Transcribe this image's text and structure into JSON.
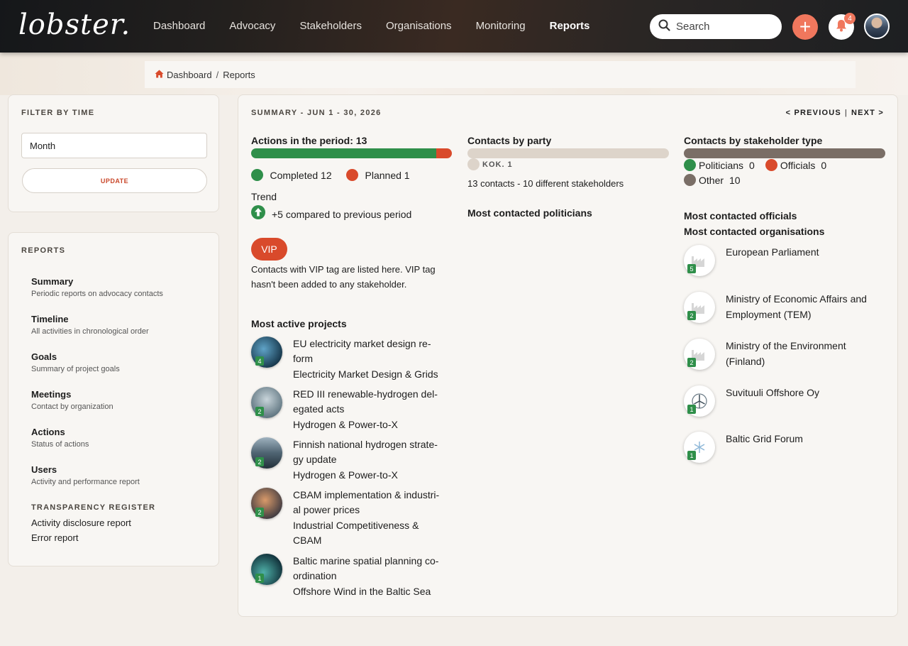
{
  "header": {
    "logo": "lobster.",
    "nav": [
      {
        "label": "Dashboard",
        "active": false
      },
      {
        "label": "Advocacy",
        "active": false
      },
      {
        "label": "Stakeholders",
        "active": false
      },
      {
        "label": "Organisations",
        "active": false
      },
      {
        "label": "Monitoring",
        "active": false
      },
      {
        "label": "Reports",
        "active": true
      }
    ],
    "search_placeholder": "Search",
    "notification_count": "4",
    "plus": "+"
  },
  "breadcrumb": {
    "home": "Dashboard",
    "sep": "/",
    "current": "Reports"
  },
  "filter": {
    "title": "FILTER BY TIME",
    "selected": "Month",
    "update_label": "UPDATE"
  },
  "reports": {
    "title": "REPORTS",
    "items": [
      {
        "title": "Summary",
        "desc": "Periodic reports on advocacy contacts"
      },
      {
        "title": "Timeline",
        "desc": "All activities in chronological order"
      },
      {
        "title": "Goals",
        "desc": "Summary of project goals"
      },
      {
        "title": "Meetings",
        "desc": "Contact by organization"
      },
      {
        "title": "Actions",
        "desc": "Status of actions"
      },
      {
        "title": "Users",
        "desc": "Activity and performance report"
      }
    ],
    "transparency_title": "TRANSPARENCY REGISTER",
    "transparency_links": [
      "Activity disclosure report",
      "Error report"
    ]
  },
  "summary": {
    "title": "SUMMARY - JUN 1 - 30, 2026",
    "prev": "< PREVIOUS",
    "pager_sep": "|",
    "next": "NEXT >",
    "actions": {
      "heading": "Actions in the period: 13",
      "completed_label": "Completed 12",
      "planned_label": "Planned 1",
      "completed": 12,
      "planned": 1,
      "colors": {
        "completed": "#2f8f4a",
        "planned": "#d94a2b"
      }
    },
    "trend": {
      "heading": "Trend",
      "text": "+5 compared to previous period"
    },
    "vip": {
      "label": "VIP",
      "text_line1": "Contacts with VIP tag are listed here. VIP tag",
      "text_line2": "hasn't been added to any stakeholder."
    },
    "projects": {
      "heading": "Most active projects",
      "items": [
        {
          "count": "4",
          "line1": "EU electricity market design re-",
          "line2": "form",
          "line3": "Electricity Market Design & Grids",
          "line4": ""
        },
        {
          "count": "2",
          "line1": "RED III renewable-hydrogen del-",
          "line2": "egated acts",
          "line3": "Hydrogen & Power-to-X",
          "line4": ""
        },
        {
          "count": "2",
          "line1": "Finnish national hydrogen strate-",
          "line2": "gy update",
          "line3": "Hydrogen & Power-to-X",
          "line4": ""
        },
        {
          "count": "2",
          "line1": "CBAM implementation & industri-",
          "line2": "al power prices",
          "line3": "Industrial Competitiveness &",
          "line4": "CBAM"
        },
        {
          "count": "1",
          "line1": "Baltic marine spatial planning co-",
          "line2": "ordination",
          "line3": "Offshore Wind in the Baltic Sea",
          "line4": ""
        }
      ]
    },
    "party": {
      "heading": "Contacts by party",
      "legend": "KOK. 1",
      "bar_color": "#ddd4ca",
      "summary": "13 contacts - 10 different stakeholders",
      "politicians_heading": "Most contacted politicians"
    },
    "stakeholder_type": {
      "heading": "Contacts by stakeholder type",
      "bar_color": "#7a6e66",
      "politicians_label": "Politicians",
      "politicians_value": "0",
      "officials_label": "Officials",
      "officials_value": "0",
      "other_label": "Other",
      "other_value": "10",
      "colors": {
        "politicians": "#2f8f4a",
        "officials": "#d94a2b",
        "other": "#7a6e66"
      }
    },
    "officials_heading": "Most contacted officials",
    "organisations": {
      "heading": "Most contacted organisations",
      "items": [
        {
          "count": "5",
          "line1": "European Parliament",
          "line2": ""
        },
        {
          "count": "2",
          "line1": "Ministry of Economic Affairs and",
          "line2": "Employment (TEM)"
        },
        {
          "count": "2",
          "line1": "Ministry of the Environment",
          "line2": "(Finland)"
        },
        {
          "count": "1",
          "line1": "Suvituuli Offshore Oy",
          "line2": ""
        },
        {
          "count": "1",
          "line1": "Baltic Grid Forum",
          "line2": ""
        }
      ]
    }
  }
}
